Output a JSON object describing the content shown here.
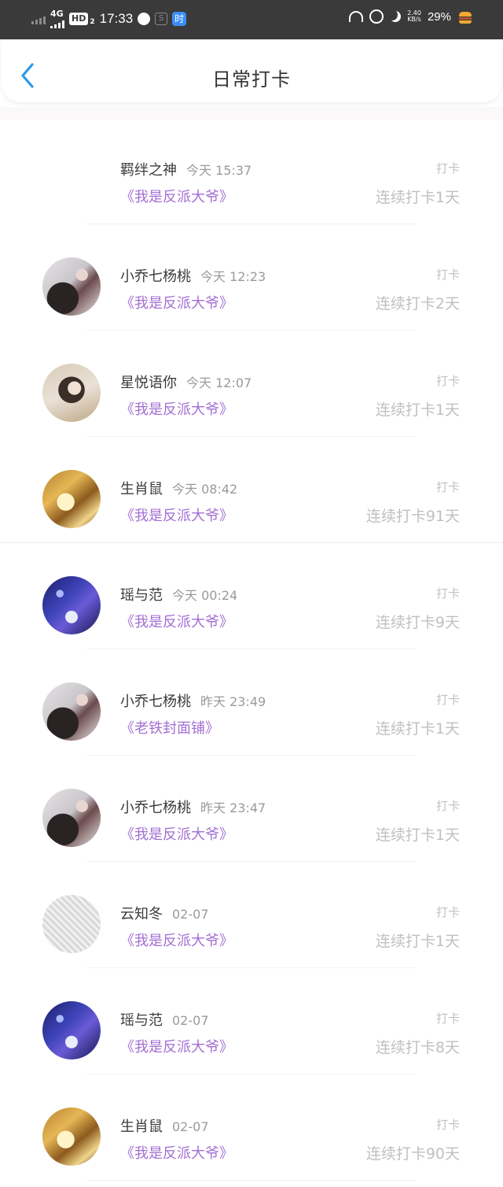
{
  "status_bar": {
    "network": "4G",
    "hd": "HD",
    "hd_sub": "2",
    "time": "17:33",
    "app_badge": "时",
    "net_speed_value": "2.40",
    "net_speed_unit": "KB/s",
    "battery": "29%"
  },
  "nav": {
    "title": "日常打卡"
  },
  "entries": [
    {
      "name": "羁绊之神",
      "time": "今天 15:37",
      "book": "《我是反派大爷》",
      "action": "打卡",
      "streak": "连续打卡1天",
      "avatar": "none"
    },
    {
      "name": "小乔七杨桃",
      "time": "今天 12:23",
      "book": "《我是反派大爷》",
      "action": "打卡",
      "streak": "连续打卡2天",
      "avatar": "kiss"
    },
    {
      "name": "星悦语你",
      "time": "今天 12:07",
      "book": "《我是反派大爷》",
      "action": "打卡",
      "streak": "连续打卡1天",
      "avatar": "lady"
    },
    {
      "name": "生肖鼠",
      "time": "今天 08:42",
      "book": "《我是反派大爷》",
      "action": "打卡",
      "streak": "连续打卡91天",
      "avatar": "gold"
    },
    {
      "name": "瑶与范",
      "time": "今天 00:24",
      "book": "《我是反派大爷》",
      "action": "打卡",
      "streak": "连续打卡9天",
      "avatar": "galaxy"
    },
    {
      "name": "小乔七杨桃",
      "time": "昨天 23:49",
      "book": "《老铁封面铺》",
      "action": "打卡",
      "streak": "连续打卡1天",
      "avatar": "kiss"
    },
    {
      "name": "小乔七杨桃",
      "time": "昨天 23:47",
      "book": "《我是反派大爷》",
      "action": "打卡",
      "streak": "连续打卡1天",
      "avatar": "kiss"
    },
    {
      "name": "云知冬",
      "time": "02-07",
      "book": "《我是反派大爷》",
      "action": "打卡",
      "streak": "连续打卡1天",
      "avatar": "sketch"
    },
    {
      "name": "瑶与范",
      "time": "02-07",
      "book": "《我是反派大爷》",
      "action": "打卡",
      "streak": "连续打卡8天",
      "avatar": "galaxy"
    },
    {
      "name": "生肖鼠",
      "time": "02-07",
      "book": "《我是反派大爷》",
      "action": "打卡",
      "streak": "连续打卡90天",
      "avatar": "gold"
    }
  ]
}
